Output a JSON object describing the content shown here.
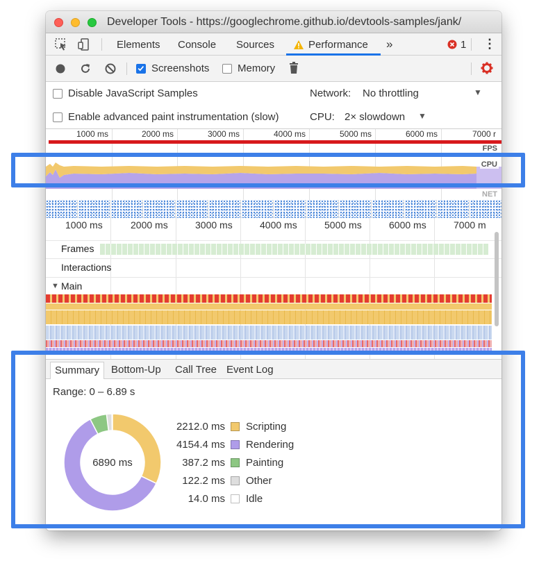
{
  "window": {
    "title": "Developer Tools - https://googlechrome.github.io/devtools-samples/jank/"
  },
  "tabbar": {
    "tabs": [
      "Elements",
      "Console",
      "Sources",
      "Performance"
    ],
    "active_tab": "Performance",
    "more_label": "»",
    "error_count": "1",
    "menu_label": "⋮"
  },
  "toolbar": {
    "screenshots_label": "Screenshots",
    "screenshots_checked": true,
    "memory_label": "Memory",
    "memory_checked": false
  },
  "settings": {
    "disable_js_samples_label": "Disable JavaScript Samples",
    "advanced_paint_label": "Enable advanced paint instrumentation (slow)",
    "network_label": "Network:",
    "network_value": "No throttling",
    "cpu_label": "CPU:",
    "cpu_value": "2× slowdown",
    "dropdown_arrow": "▼"
  },
  "overview": {
    "ticks": [
      "1000 ms",
      "2000 ms",
      "3000 ms",
      "4000 ms",
      "5000 ms",
      "6000 ms",
      "7000 r"
    ],
    "fps_label": "FPS",
    "cpu_label": "CPU",
    "net_label": "NET"
  },
  "flamechart": {
    "ticks": [
      "1000 ms",
      "2000 ms",
      "3000 ms",
      "4000 ms",
      "5000 ms",
      "6000 ms",
      "7000 m"
    ],
    "frames_label": "Frames",
    "interactions_label": "Interactions",
    "main_label": "Main",
    "main_toggle": "▼"
  },
  "summary": {
    "tabs": [
      "Summary",
      "Bottom-Up",
      "Call Tree",
      "Event Log"
    ],
    "active_tab": "Summary",
    "range": "Range: 0 – 6.89 s",
    "total": "6890 ms",
    "items": [
      {
        "value": "2212.0 ms",
        "name": "Scripting",
        "color": "#f2c96d"
      },
      {
        "value": "4154.4 ms",
        "name": "Rendering",
        "color": "#af9ce9"
      },
      {
        "value": "387.2 ms",
        "name": "Painting",
        "color": "#8dc783"
      },
      {
        "value": "122.2 ms",
        "name": "Other",
        "color": "#dedede"
      },
      {
        "value": "14.0 ms",
        "name": "Idle",
        "color": "#ffffff"
      }
    ]
  },
  "colors": {
    "accent": "#1a73e8",
    "highlight": "#3d7fe8",
    "fps_red": "#d7191c",
    "settings_gear": "#d93025",
    "error": "#d93025"
  }
}
